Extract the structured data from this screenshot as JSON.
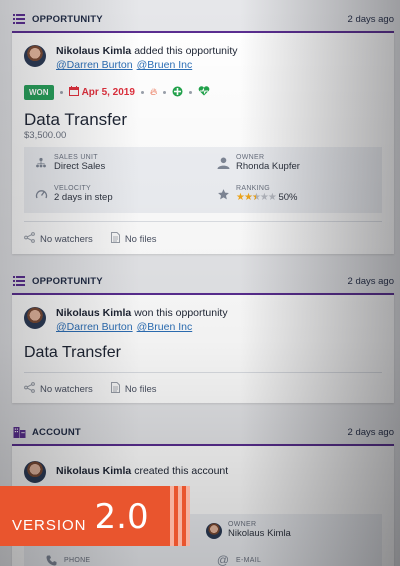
{
  "activities": [
    {
      "header": {
        "type_label": "OPPORTUNITY",
        "time": "2 days ago"
      },
      "actor": {
        "name": "Nikolaus Kimla",
        "action": "added this opportunity"
      },
      "mentions": [
        "@Darren Burton",
        "@Bruen Inc"
      ],
      "status_badge": "WON",
      "close_date": "Apr 5, 2019",
      "title": "Data Transfer",
      "amount": "$3,500.00",
      "fields": {
        "sales_unit": {
          "label": "SALES UNIT",
          "value": "Direct Sales"
        },
        "owner": {
          "label": "OWNER",
          "value": "Rhonda Kupfer"
        },
        "velocity": {
          "label": "VELOCITY",
          "value": "2 days in step"
        },
        "ranking": {
          "label": "RANKING",
          "value": "50%",
          "stars": 2.5
        }
      },
      "footer": {
        "watchers": "No watchers",
        "files": "No files"
      }
    },
    {
      "header": {
        "type_label": "OPPORTUNITY",
        "time": "2 days ago"
      },
      "actor": {
        "name": "Nikolaus Kimla",
        "action": "won this opportunity"
      },
      "mentions": [
        "@Darren Burton",
        "@Bruen Inc"
      ],
      "title": "Data Transfer",
      "footer": {
        "watchers": "No watchers",
        "files": "No files"
      }
    },
    {
      "header": {
        "type_label": "ACCOUNT",
        "time": "2 days ago"
      },
      "actor": {
        "name": "Nikolaus Kimla",
        "action": "created this account"
      },
      "fields": {
        "owner": {
          "label": "OWNER",
          "value": "Nikolaus Kimla"
        },
        "phone": {
          "label": "PHONE"
        },
        "email": {
          "label": "E-MAIL"
        }
      }
    }
  ],
  "version_banner": {
    "word": "VERSION",
    "number": "2.0"
  },
  "colors": {
    "accent": "#5a2d91",
    "won": "#27a05a",
    "date": "#e0303d",
    "link": "#2c6fb7",
    "banner": "#e9552e",
    "star": "#f2a81d"
  }
}
